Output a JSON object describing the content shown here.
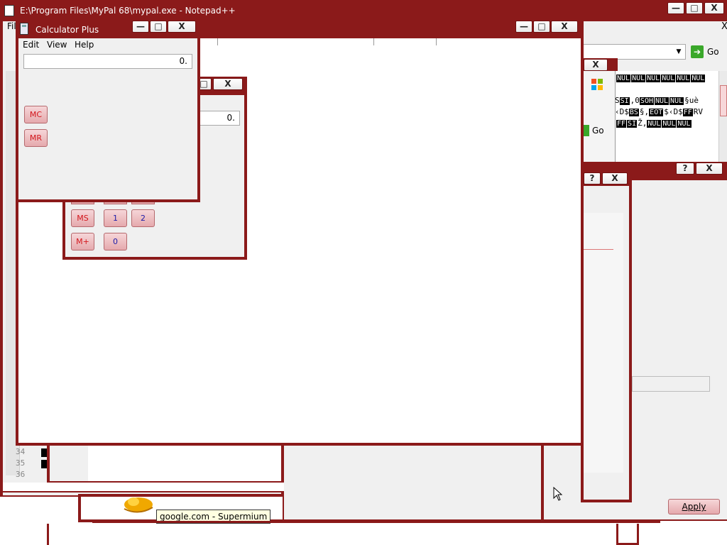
{
  "notepadpp": {
    "title": "E:\\Program Files\\MyPal 68\\mypal.exe - Notepad++",
    "menu_first": "Fil",
    "line_numbers": [
      "34",
      "35",
      "36"
    ],
    "go_label": "Go",
    "close_glyph": "X"
  },
  "calculator": {
    "title": "Calculator Plus",
    "menu": [
      "Edit",
      "View",
      "Help"
    ],
    "display": "0.",
    "buttons": [
      "MC",
      "MR"
    ]
  },
  "calculator_back": {
    "display": "0.",
    "buttons": [
      "MS",
      "1",
      "2",
      "M+",
      "0"
    ]
  },
  "hex_window": {
    "line1": [
      "NUL",
      "NUL",
      "NUL",
      "NUL",
      "NUL",
      "NUL"
    ],
    "line2_prefix": "S",
    "line2": [
      "SI",
      "SOH",
      "NUL",
      "NUL"
    ],
    "line2_texts": [
      ",0",
      "",
      "",
      "",
      "§uè"
    ],
    "line3_texts": [
      "‹D$",
      "§,",
      "$‹D$",
      "RV"
    ],
    "line3_ctrls": [
      "BS",
      "EOT",
      "FF"
    ],
    "line4_ctrls": [
      "FF",
      "SI"
    ],
    "line4_text": "Ž,",
    "line4_nuls": [
      "NUL",
      "NUL",
      "NUL"
    ],
    "go_label": "Go"
  },
  "dialog": {
    "help_glyph": "?",
    "close_glyph": "X",
    "apply_label": "Apply"
  },
  "tooltip": "google.com - Supermium",
  "window_buttons": {
    "minimize": "—",
    "maximize": "□",
    "close": "X"
  }
}
